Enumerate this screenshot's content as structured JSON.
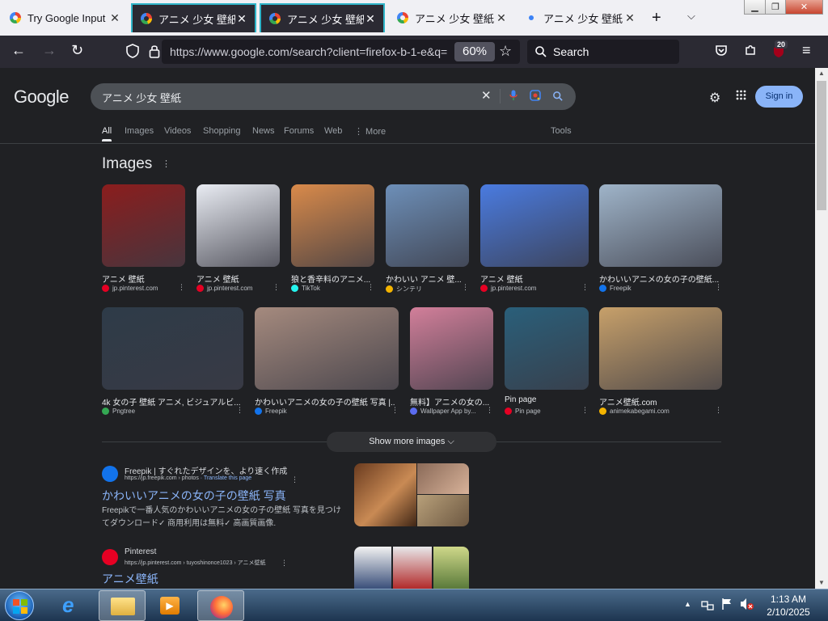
{
  "browser": {
    "tabs": [
      {
        "title": "Try Google Input T",
        "favicon": "google-g-icon"
      },
      {
        "title": "アニメ 少女 壁紙 -",
        "favicon": "google-g-icon"
      },
      {
        "title": "アニメ 少女 壁紙 -",
        "favicon": "google-g-icon"
      },
      {
        "title": "アニメ 少女 壁紙 -",
        "favicon": "google-g-icon"
      },
      {
        "title": "アニメ 少女 壁紙 -",
        "favicon": "loading-dot-icon"
      }
    ],
    "url": "https://www.google.com/search?client=firefox-b-1-e&q=",
    "zoom": "60%",
    "search_placeholder": "Search",
    "extensions_badge": "20",
    "accent": "#2fb5c9"
  },
  "google": {
    "logo": "Google",
    "query": "アニメ 少女 壁紙",
    "tabs": [
      "All",
      "Images",
      "Videos",
      "Shopping",
      "News",
      "Forums",
      "Web",
      "⋮ More",
      "Tools"
    ],
    "sign_in": "Sign in",
    "images_heading": "Images",
    "images": [
      {
        "caption": "アニメ 壁紙",
        "source": "jp.pinterest.com",
        "tint": "#8b1d1d",
        "icon": "#e60023"
      },
      {
        "caption": "アニメ 壁紙",
        "source": "jp.pinterest.com",
        "tint": "#e9ecf3",
        "icon": "#e60023"
      },
      {
        "caption": "狼と香辛料のアニメ...",
        "source": "TikTok",
        "tint": "#d98a4a",
        "icon": "#25f4ee"
      },
      {
        "caption": "かわいい アニメ 壁...",
        "source": "シンテリ",
        "tint": "#6d8fb8",
        "icon": "#f4b400"
      },
      {
        "caption": "アニメ 壁紙",
        "source": "jp.pinterest.com",
        "tint": "#4a7be0",
        "icon": "#e60023"
      },
      {
        "caption": "かわいいアニメの女の子の壁紙...",
        "source": "Freepik",
        "tint": "#9fb4c9",
        "icon": "#1273eb"
      },
      {
        "caption": "4k 女の子 壁紙 アニメ, ビジュアルビ...",
        "source": "Pngtree",
        "tint": "#2e3b48",
        "icon": "#34a853"
      },
      {
        "caption": "かわいいアニメの女の子の壁紙 写真 |...",
        "source": "Freepik",
        "tint": "#a58a7e",
        "icon": "#1273eb"
      },
      {
        "caption": "無料】アニメの女の...",
        "source": "Wallpaper App by...",
        "tint": "#d27f9a",
        "icon": "#5b6cf0"
      },
      {
        "caption": "Pin page",
        "source": "Pin page",
        "tint": "#2a5f7a",
        "icon": "#e60023"
      },
      {
        "caption": "アニメ壁紙.com",
        "source": "animekabegami.com",
        "tint": "#c7a06a",
        "icon": "#f4b400"
      }
    ],
    "show_more": "Show more images",
    "results": [
      {
        "site": "Freepik | すぐれたデザインを、より速く作成",
        "crumb": "https://jp.freepik.com › photos",
        "translate": "· Translate this page",
        "title": "かわいいアニメの女の子の壁紙 写真",
        "snippet": "Freepikで一番人気のかわいいアニメの女の子の壁紙 写真を見つけてダウンロード✓ 商用利用は無料✓ 高画質画像.",
        "logo_color": "#1273eb"
      },
      {
        "site": "Pinterest",
        "crumb": "https://jp.pinterest.com › tuyoshinonce1023 › アニメ壁紙",
        "translate": "",
        "title": "アニメ壁紙",
        "snippet": "",
        "logo_color": "#e60023"
      }
    ]
  },
  "taskbar": {
    "time": "1:13 AM",
    "date": "2/10/2025"
  }
}
